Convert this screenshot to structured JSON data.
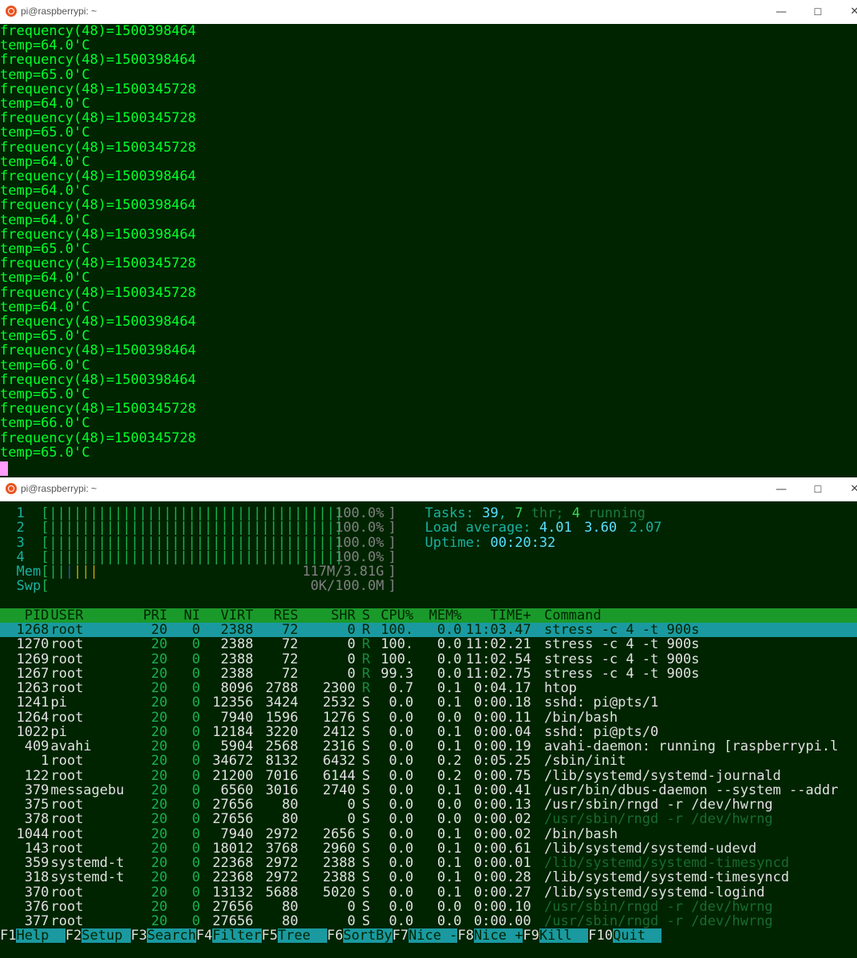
{
  "win1": {
    "title": "pi@raspberrypi: ~",
    "lines": [
      "frequency(48)=1500398464",
      "temp=64.0'C",
      "frequency(48)=1500398464",
      "temp=65.0'C",
      "frequency(48)=1500345728",
      "temp=64.0'C",
      "frequency(48)=1500345728",
      "temp=65.0'C",
      "frequency(48)=1500345728",
      "temp=64.0'C",
      "frequency(48)=1500398464",
      "temp=64.0'C",
      "frequency(48)=1500398464",
      "temp=64.0'C",
      "frequency(48)=1500398464",
      "temp=65.0'C",
      "frequency(48)=1500345728",
      "temp=64.0'C",
      "frequency(48)=1500345728",
      "temp=64.0'C",
      "frequency(48)=1500398464",
      "temp=65.0'C",
      "frequency(48)=1500398464",
      "temp=66.0'C",
      "frequency(48)=1500398464",
      "temp=65.0'C",
      "frequency(48)=1500345728",
      "temp=66.0'C",
      "frequency(48)=1500345728",
      "temp=65.0'C"
    ]
  },
  "win2": {
    "title": "pi@raspberrypi: ~",
    "cpus": [
      {
        "label": "1",
        "value": "100.0%"
      },
      {
        "label": "2",
        "value": "100.0%"
      },
      {
        "label": "3",
        "value": "100.0%"
      },
      {
        "label": "4",
        "value": "100.0%"
      }
    ],
    "mem": {
      "label": "Mem",
      "value": "117M/3.81G"
    },
    "swp": {
      "label": "Swp",
      "value": "0K/100.0M"
    },
    "tasks": {
      "label": "Tasks:",
      "count": "39",
      "thr": "7",
      "thr_label": "thr;",
      "running": "4",
      "running_label": "running"
    },
    "load": {
      "label": "Load average:",
      "l1": "4.01",
      "l5": "3.60",
      "l15": "2.07"
    },
    "uptime": {
      "label": "Uptime:",
      "value": "00:20:32"
    },
    "columns": [
      "PID",
      "USER",
      "PRI",
      "NI",
      "VIRT",
      "RES",
      "SHR",
      "S",
      "CPU%",
      "MEM%",
      "TIME+",
      "Command"
    ],
    "processes": [
      [
        "1268",
        "root",
        "20",
        "0",
        "2388",
        "72",
        "0",
        "R",
        "100.",
        "0.0",
        "11:03.47",
        "stress -c 4 -t 900s"
      ],
      [
        "1270",
        "root",
        "20",
        "0",
        "2388",
        "72",
        "0",
        "R",
        "100.",
        "0.0",
        "11:02.21",
        "stress -c 4 -t 900s"
      ],
      [
        "1269",
        "root",
        "20",
        "0",
        "2388",
        "72",
        "0",
        "R",
        "100.",
        "0.0",
        "11:02.54",
        "stress -c 4 -t 900s"
      ],
      [
        "1267",
        "root",
        "20",
        "0",
        "2388",
        "72",
        "0",
        "R",
        "99.3",
        "0.0",
        "11:02.75",
        "stress -c 4 -t 900s"
      ],
      [
        "1263",
        "root",
        "20",
        "0",
        "8096",
        "2788",
        "2300",
        "R",
        "0.7",
        "0.1",
        "0:04.17",
        "htop"
      ],
      [
        "1241",
        "pi",
        "20",
        "0",
        "12356",
        "3424",
        "2532",
        "S",
        "0.0",
        "0.1",
        "0:00.18",
        "sshd: pi@pts/1"
      ],
      [
        "1264",
        "root",
        "20",
        "0",
        "7940",
        "1596",
        "1276",
        "S",
        "0.0",
        "0.0",
        "0:00.11",
        "/bin/bash"
      ],
      [
        "1022",
        "pi",
        "20",
        "0",
        "12184",
        "3220",
        "2412",
        "S",
        "0.0",
        "0.1",
        "0:00.04",
        "sshd: pi@pts/0"
      ],
      [
        "409",
        "avahi",
        "20",
        "0",
        "5904",
        "2568",
        "2316",
        "S",
        "0.0",
        "0.1",
        "0:00.19",
        "avahi-daemon: running [raspberrypi.l"
      ],
      [
        "1",
        "root",
        "20",
        "0",
        "34672",
        "8132",
        "6432",
        "S",
        "0.0",
        "0.2",
        "0:05.25",
        "/sbin/init"
      ],
      [
        "122",
        "root",
        "20",
        "0",
        "21200",
        "7016",
        "6144",
        "S",
        "0.0",
        "0.2",
        "0:00.75",
        "/lib/systemd/systemd-journald"
      ],
      [
        "379",
        "messagebu",
        "20",
        "0",
        "6560",
        "3016",
        "2740",
        "S",
        "0.0",
        "0.1",
        "0:00.41",
        "/usr/bin/dbus-daemon --system --addr"
      ],
      [
        "375",
        "root",
        "20",
        "0",
        "27656",
        "80",
        "0",
        "S",
        "0.0",
        "0.0",
        "0:00.13",
        "/usr/sbin/rngd -r /dev/hwrng"
      ],
      [
        "378",
        "root",
        "20",
        "0",
        "27656",
        "80",
        "0",
        "S",
        "0.0",
        "0.0",
        "0:00.02",
        "/usr/sbin/rngd -r /dev/hwrng"
      ],
      [
        "1044",
        "root",
        "20",
        "0",
        "7940",
        "2972",
        "2656",
        "S",
        "0.0",
        "0.1",
        "0:00.02",
        "/bin/bash"
      ],
      [
        "143",
        "root",
        "20",
        "0",
        "18012",
        "3768",
        "2960",
        "S",
        "0.0",
        "0.1",
        "0:00.61",
        "/lib/systemd/systemd-udevd"
      ],
      [
        "359",
        "systemd-t",
        "20",
        "0",
        "22368",
        "2972",
        "2388",
        "S",
        "0.0",
        "0.1",
        "0:00.01",
        "/lib/systemd/systemd-timesyncd"
      ],
      [
        "318",
        "systemd-t",
        "20",
        "0",
        "22368",
        "2972",
        "2388",
        "S",
        "0.0",
        "0.1",
        "0:00.28",
        "/lib/systemd/systemd-timesyncd"
      ],
      [
        "370",
        "root",
        "20",
        "0",
        "13132",
        "5688",
        "5020",
        "S",
        "0.0",
        "0.1",
        "0:00.27",
        "/lib/systemd/systemd-logind"
      ],
      [
        "376",
        "root",
        "20",
        "0",
        "27656",
        "80",
        "0",
        "S",
        "0.0",
        "0.0",
        "0:00.10",
        "/usr/sbin/rngd -r /dev/hwrng"
      ],
      [
        "377",
        "root",
        "20",
        "0",
        "27656",
        "80",
        "0",
        "S",
        "0.0",
        "0.0",
        "0:00.00",
        "/usr/sbin/rngd -r /dev/hwrng"
      ]
    ],
    "fkeys": [
      {
        "key": "F1",
        "label": "Help  "
      },
      {
        "key": "F2",
        "label": "Setup "
      },
      {
        "key": "F3",
        "label": "Search"
      },
      {
        "key": "F4",
        "label": "Filter"
      },
      {
        "key": "F5",
        "label": "Tree  "
      },
      {
        "key": "F6",
        "label": "SortBy"
      },
      {
        "key": "F7",
        "label": "Nice -"
      },
      {
        "key": "F8",
        "label": "Nice +"
      },
      {
        "key": "F9",
        "label": "Kill  "
      },
      {
        "key": "F10",
        "label": "Quit"
      }
    ]
  }
}
